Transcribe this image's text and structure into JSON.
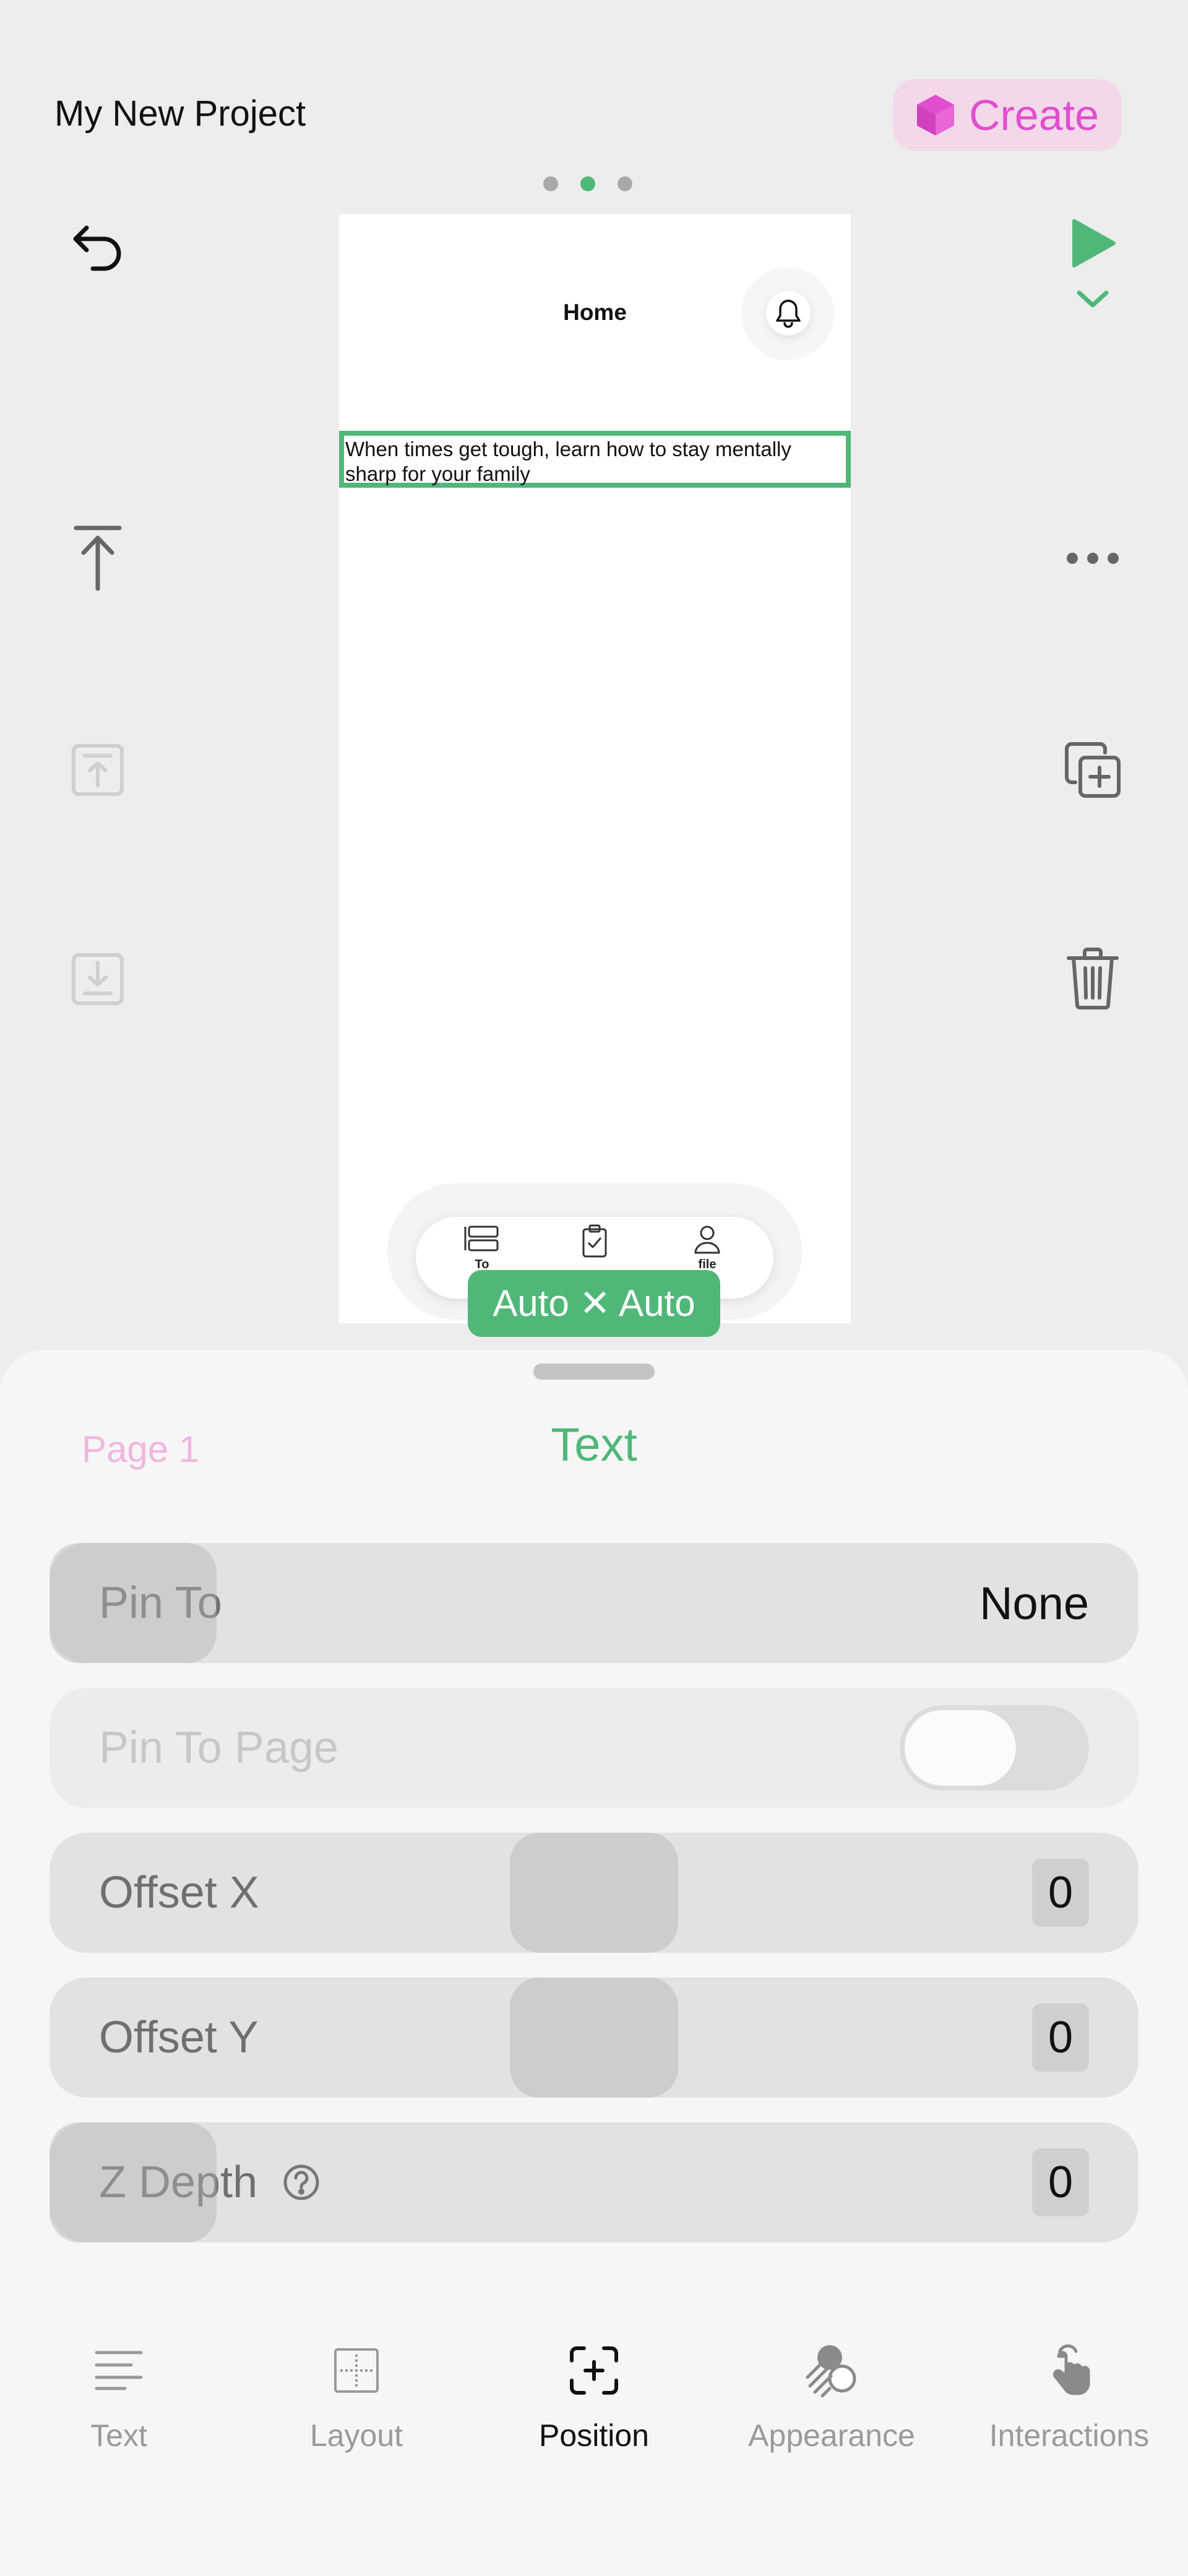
{
  "header": {
    "project_title": "My New Project",
    "create_label": "Create",
    "page_dots": {
      "count": 3,
      "active_index": 1
    }
  },
  "colors": {
    "accent_green": "#4fb879",
    "create_pink": "#e14ed0",
    "create_bg": "#f3d8ea"
  },
  "left_tools": [
    "undo-icon",
    "move-to-top-icon",
    "bring-forward-icon",
    "send-backward-icon"
  ],
  "right_tools": [
    "play-icon",
    "chevron-down-icon",
    "more-icon",
    "duplicate-icon",
    "trash-icon"
  ],
  "canvas": {
    "screen_title": "Home",
    "selected_text": "When times get tough, learn how to stay mentally sharp for your family",
    "tab_bar_items": [
      {
        "label": "To",
        "icon": "list-icon"
      },
      {
        "label": "",
        "icon": "clipboard-icon"
      },
      {
        "label": "file",
        "icon": "person-icon"
      }
    ],
    "size_badge": "Auto ✕ Auto"
  },
  "sheet": {
    "breadcrumb": "Page 1",
    "title": "Text",
    "rows": {
      "pin_to": {
        "label": "Pin To",
        "value": "None"
      },
      "pin_to_page": {
        "label": "Pin To Page",
        "toggle_on": false
      },
      "offset_x": {
        "label": "Offset X",
        "value": "0"
      },
      "offset_y": {
        "label": "Offset Y",
        "value": "0"
      },
      "z_depth": {
        "label": "Z Depth",
        "value": "0"
      }
    }
  },
  "bottom_tabs": [
    {
      "label": "Text",
      "icon": "text-lines-icon",
      "active": false
    },
    {
      "label": "Layout",
      "icon": "layout-icon",
      "active": false
    },
    {
      "label": "Position",
      "icon": "position-icon",
      "active": true
    },
    {
      "label": "Appearance",
      "icon": "appearance-icon",
      "active": false
    },
    {
      "label": "Interactions",
      "icon": "interactions-icon",
      "active": false
    }
  ]
}
